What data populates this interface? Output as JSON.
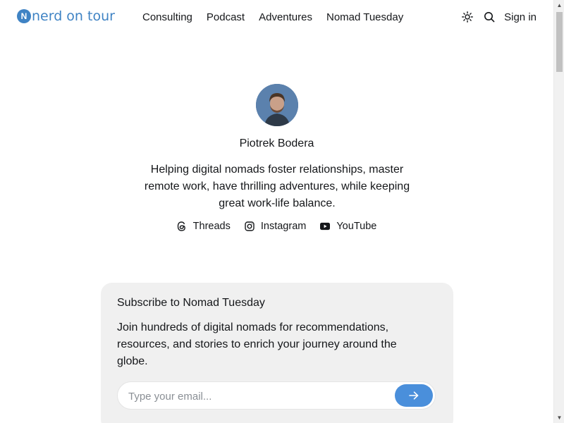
{
  "header": {
    "logo_text": "nerd on tour",
    "logo_mark": "N",
    "nav": [
      {
        "label": "Consulting"
      },
      {
        "label": "Podcast"
      },
      {
        "label": "Adventures"
      },
      {
        "label": "Nomad Tuesday"
      }
    ],
    "sign_in_label": "Sign in",
    "icons": [
      "theme-toggle-sun-icon",
      "search-icon"
    ]
  },
  "profile": {
    "name": "Piotrek Bodera",
    "bio": "Helping digital nomads foster relationships, master remote work, have thrilling adventures, while keeping great work-life balance.",
    "socials": [
      {
        "label": "Threads",
        "icon": "threads-icon"
      },
      {
        "label": "Instagram",
        "icon": "instagram-icon"
      },
      {
        "label": "YouTube",
        "icon": "youtube-icon"
      }
    ]
  },
  "subscribe": {
    "title": "Subscribe to Nomad Tuesday",
    "description": "Join hundreds of digital nomads for recommendations, resources, and stories to enrich your journey around the globe.",
    "email_placeholder": "Type your email...",
    "submit_icon": "arrow-right-icon"
  },
  "colors": {
    "brand": "#3f83c4",
    "button": "#4a8fdb",
    "card_bg": "#f0f0f0"
  }
}
